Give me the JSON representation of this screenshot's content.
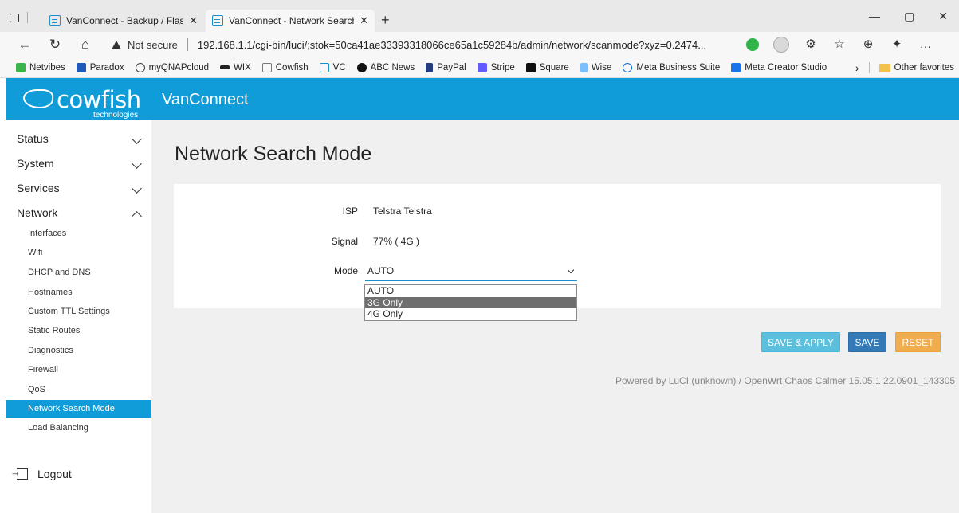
{
  "browser": {
    "tabs": [
      {
        "title": "VanConnect - Backup / Flash Firm",
        "active": false
      },
      {
        "title": "VanConnect - Network Search M",
        "active": true
      }
    ],
    "new_tab": "+",
    "window_controls": {
      "minimize": "—",
      "restore": "▢",
      "close": "✕"
    },
    "not_secure": "Not secure",
    "url": "192.168.1.1/cgi-bin/luci/;stok=50ca41ae33393318066ce65a1c59284b/admin/network/scanmode?xyz=0.2474...",
    "bookmarks": [
      {
        "label": "Netvibes",
        "color": "#3cb44b"
      },
      {
        "label": "Paradox",
        "color": "#1e5bb8"
      },
      {
        "label": "myQNAPcloud",
        "color": "#3a3a3a"
      },
      {
        "label": "WIX",
        "color": "#222222"
      },
      {
        "label": "Cowfish",
        "color": "#777777"
      },
      {
        "label": "VC",
        "color": "#1a8fcd"
      },
      {
        "label": "ABC News",
        "color": "#111111"
      },
      {
        "label": "PayPal",
        "color": "#253b80"
      },
      {
        "label": "Stripe",
        "color": "#635bff"
      },
      {
        "label": "Square",
        "color": "#111111"
      },
      {
        "label": "Wise",
        "color": "#7bbfff"
      },
      {
        "label": "Meta Business Suite",
        "color": "#0668e1"
      },
      {
        "label": "Meta Creator Studio",
        "color": "#1a73e8"
      }
    ],
    "bookmarks_more": "›",
    "other_favorites": "Other favorites"
  },
  "app": {
    "logo_word": "cowfish",
    "logo_sub": "technologies",
    "title": "VanConnect",
    "accent_color": "#0f9cd8"
  },
  "sidebar": {
    "sections": [
      {
        "label": "Status",
        "expanded": false
      },
      {
        "label": "System",
        "expanded": false
      },
      {
        "label": "Services",
        "expanded": false
      },
      {
        "label": "Network",
        "expanded": true
      }
    ],
    "network_items": [
      "Interfaces",
      "Wifi",
      "DHCP and DNS",
      "Hostnames",
      "Custom TTL Settings",
      "Static Routes",
      "Diagnostics",
      "Firewall",
      "QoS",
      "Network Search Mode",
      "Load Balancing"
    ],
    "active_item": "Network Search Mode",
    "logout": "Logout"
  },
  "main": {
    "page_title": "Network Search Mode",
    "isp_label": "ISP",
    "isp_value": "Telstra Telstra",
    "signal_label": "Signal",
    "signal_value": "77% ( 4G )",
    "mode_label": "Mode",
    "mode_value": "AUTO",
    "mode_options": [
      "AUTO",
      "3G Only",
      "4G Only"
    ],
    "highlighted_option": "3G Only",
    "buttons": {
      "save_apply": "SAVE & APPLY",
      "save": "SAVE",
      "reset": "RESET"
    },
    "footer": "Powered by LuCI (unknown) / OpenWrt Chaos Calmer 15.05.1 22.0901_143305"
  }
}
